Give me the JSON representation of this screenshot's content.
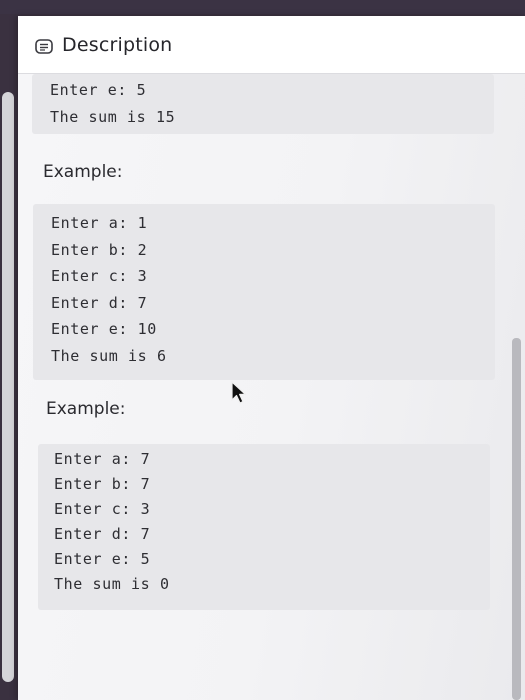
{
  "header": {
    "title": "Description",
    "icon": "message-lines-icon"
  },
  "top_block": {
    "lines": [
      "Enter e: 5",
      "The sum is 15"
    ]
  },
  "example1": {
    "title": "Example:",
    "lines": [
      "Enter a: 1",
      "Enter b: 2",
      "Enter c: 3",
      "Enter d: 7",
      "Enter e: 10",
      "The sum is 6"
    ]
  },
  "example2": {
    "title": "Example:",
    "lines": [
      "Enter a: 7",
      "Enter b: 7",
      "Enter c: 3",
      "Enter d: 7",
      "Enter e: 5",
      "The sum is 0"
    ]
  },
  "cursor": {
    "icon": "mouse-pointer-icon"
  },
  "colors": {
    "panel_bg": "#f4f4f6",
    "code_bg": "#e7e7ea",
    "text": "#2e2e33",
    "frame": "#3b3344"
  }
}
